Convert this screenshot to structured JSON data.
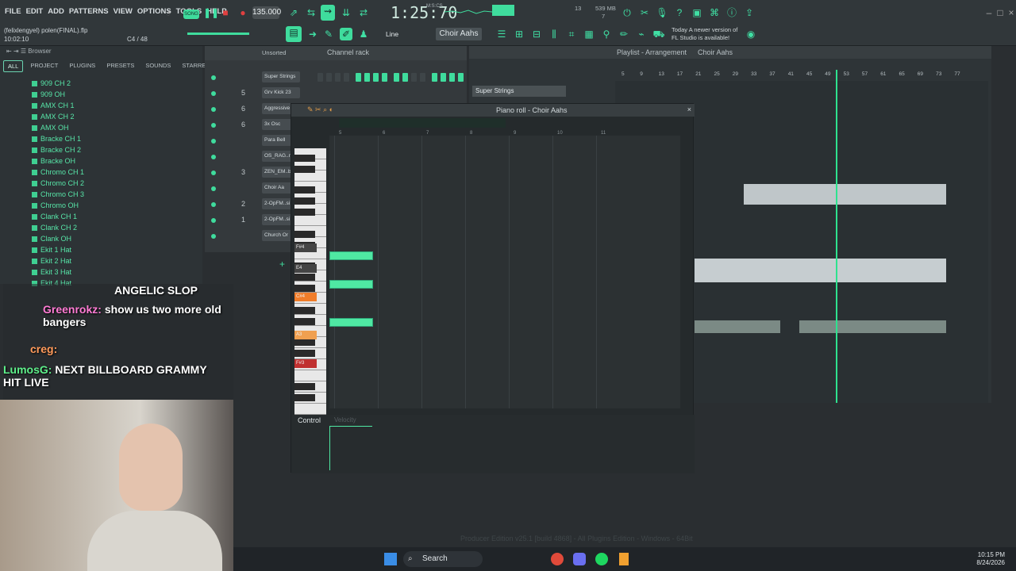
{
  "menu": [
    "FILE",
    "EDIT",
    "ADD",
    "PATTERNS",
    "VIEW",
    "OPTIONS",
    "TOOLS",
    "HELP"
  ],
  "project": {
    "user": "(felixlengyel)",
    "file": "polen(FINAL).flp",
    "time": "10:02:10",
    "note": "C4 / 48"
  },
  "transport": {
    "mode": "SONG",
    "tempo": "135.000",
    "song_time": "1:25:70",
    "mcs": "M:S:CS",
    "cpu": "13",
    "mem": "539 MB",
    "poly": "7"
  },
  "toolbar": {
    "snap": "Line",
    "pattern": "Choir Aahs"
  },
  "news": {
    "line1": "Today",
    "line2": "A newer version of",
    "line3": "FL Studio is available!"
  },
  "browser": {
    "title": "Browser",
    "tabs": [
      "ALL",
      "PROJECT",
      "PLUGINS",
      "PRESETS",
      "SOUNDS",
      "STARRED"
    ],
    "items": [
      "909 CH 2",
      "909 OH",
      "AMX CH 1",
      "AMX CH 2",
      "AMX OH",
      "Bracke CH 1",
      "Bracke CH 2",
      "Bracke OH",
      "Chromo CH 1",
      "Chromo CH 2",
      "Chromo CH 3",
      "Chromo OH",
      "Clank CH 1",
      "Clank CH 2",
      "Clank OH",
      "Ekit 1 Hat",
      "Ekit 2 Hat",
      "Ekit 3 Hat",
      "Ekit 4 Hat"
    ]
  },
  "chat": [
    {
      "user": "",
      "msg": "ANGELIC SLOP"
    },
    {
      "user": "Greenrokz:",
      "msg": "show us two more old bangers"
    },
    {
      "user": "creg:",
      "msg": ""
    },
    {
      "user": "LumosG:",
      "msg": "NEXT BILLBOARD GRAMMY HIT LIVE"
    }
  ],
  "channel_rack": {
    "title": "Channel rack",
    "filter": "Unsorted",
    "channels": [
      {
        "num": "",
        "name": "Super Strings"
      },
      {
        "num": "5",
        "name": "Grv Kick 23"
      },
      {
        "num": "6",
        "name": "Aggressive"
      },
      {
        "num": "6",
        "name": "3x Osc"
      },
      {
        "num": "",
        "name": "Para Bell"
      },
      {
        "num": "",
        "name": "OS_RAG..n"
      },
      {
        "num": "3",
        "name": "ZEN_EM..b"
      },
      {
        "num": "",
        "name": "Choir Aa"
      },
      {
        "num": "2",
        "name": "2-OpFM..si"
      },
      {
        "num": "1",
        "name": "2-OpFM..si"
      },
      {
        "num": "",
        "name": "Church Or"
      }
    ]
  },
  "piano_roll": {
    "title": "Piano roll - Choir Aahs",
    "bars": [
      "5",
      "6",
      "7",
      "8",
      "9",
      "10",
      "11"
    ],
    "key_labels": [
      "F#4",
      "E4",
      "C#4",
      "A3",
      "F#3"
    ],
    "control": "Control",
    "velocity": "Velocity",
    "notes": [
      {
        "pitch": "E4",
        "start": 4.0,
        "length": 1.0
      },
      {
        "pitch": "C#4",
        "start": 4.0,
        "length": 1.0
      },
      {
        "pitch": "A3",
        "start": 4.0,
        "length": 1.0
      }
    ]
  },
  "playlist": {
    "title": "Playlist - Arrangement",
    "pattern": "Choir Aahs",
    "track": "Super Strings",
    "ruler": [
      "5",
      "9",
      "13",
      "17",
      "21",
      "25",
      "29",
      "33",
      "37",
      "41",
      "45",
      "49",
      "53",
      "57",
      "61",
      "65",
      "69",
      "73",
      "77"
    ]
  },
  "taskbar": {
    "search": "Search",
    "time": "10:15 PM",
    "date": "8/24/2026"
  },
  "edition": "Producer Edition v25.1 [build 4868] - All Plugins Edition - Windows - 64Bit",
  "colors": {
    "accent": "#3fdc9d",
    "bg": "#2a2e31",
    "panel": "#34393c"
  }
}
